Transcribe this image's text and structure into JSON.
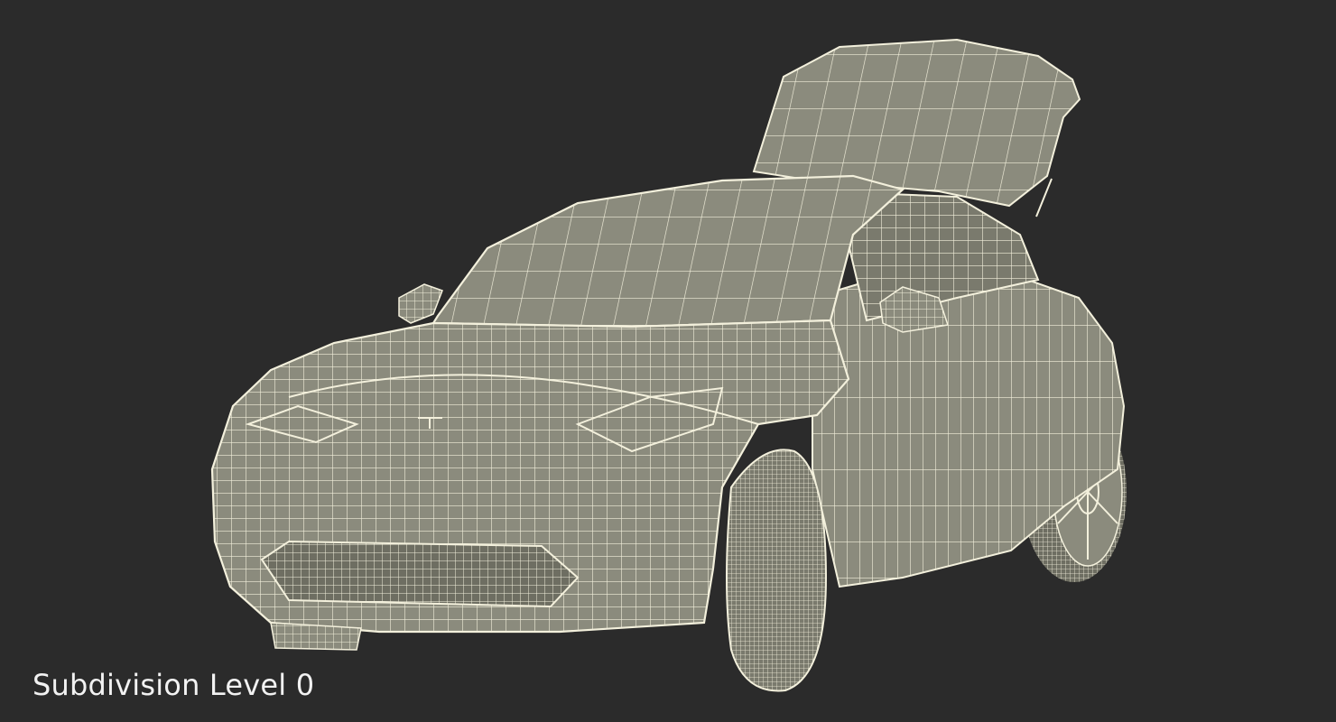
{
  "caption": "Subdivision Level 0",
  "colors": {
    "background": "#2b2b2b",
    "surface": "#8b8b7d",
    "surface_dark": "#6e6e62",
    "wire": "#f3f0dc",
    "caption_text": "#f2f2f2"
  }
}
